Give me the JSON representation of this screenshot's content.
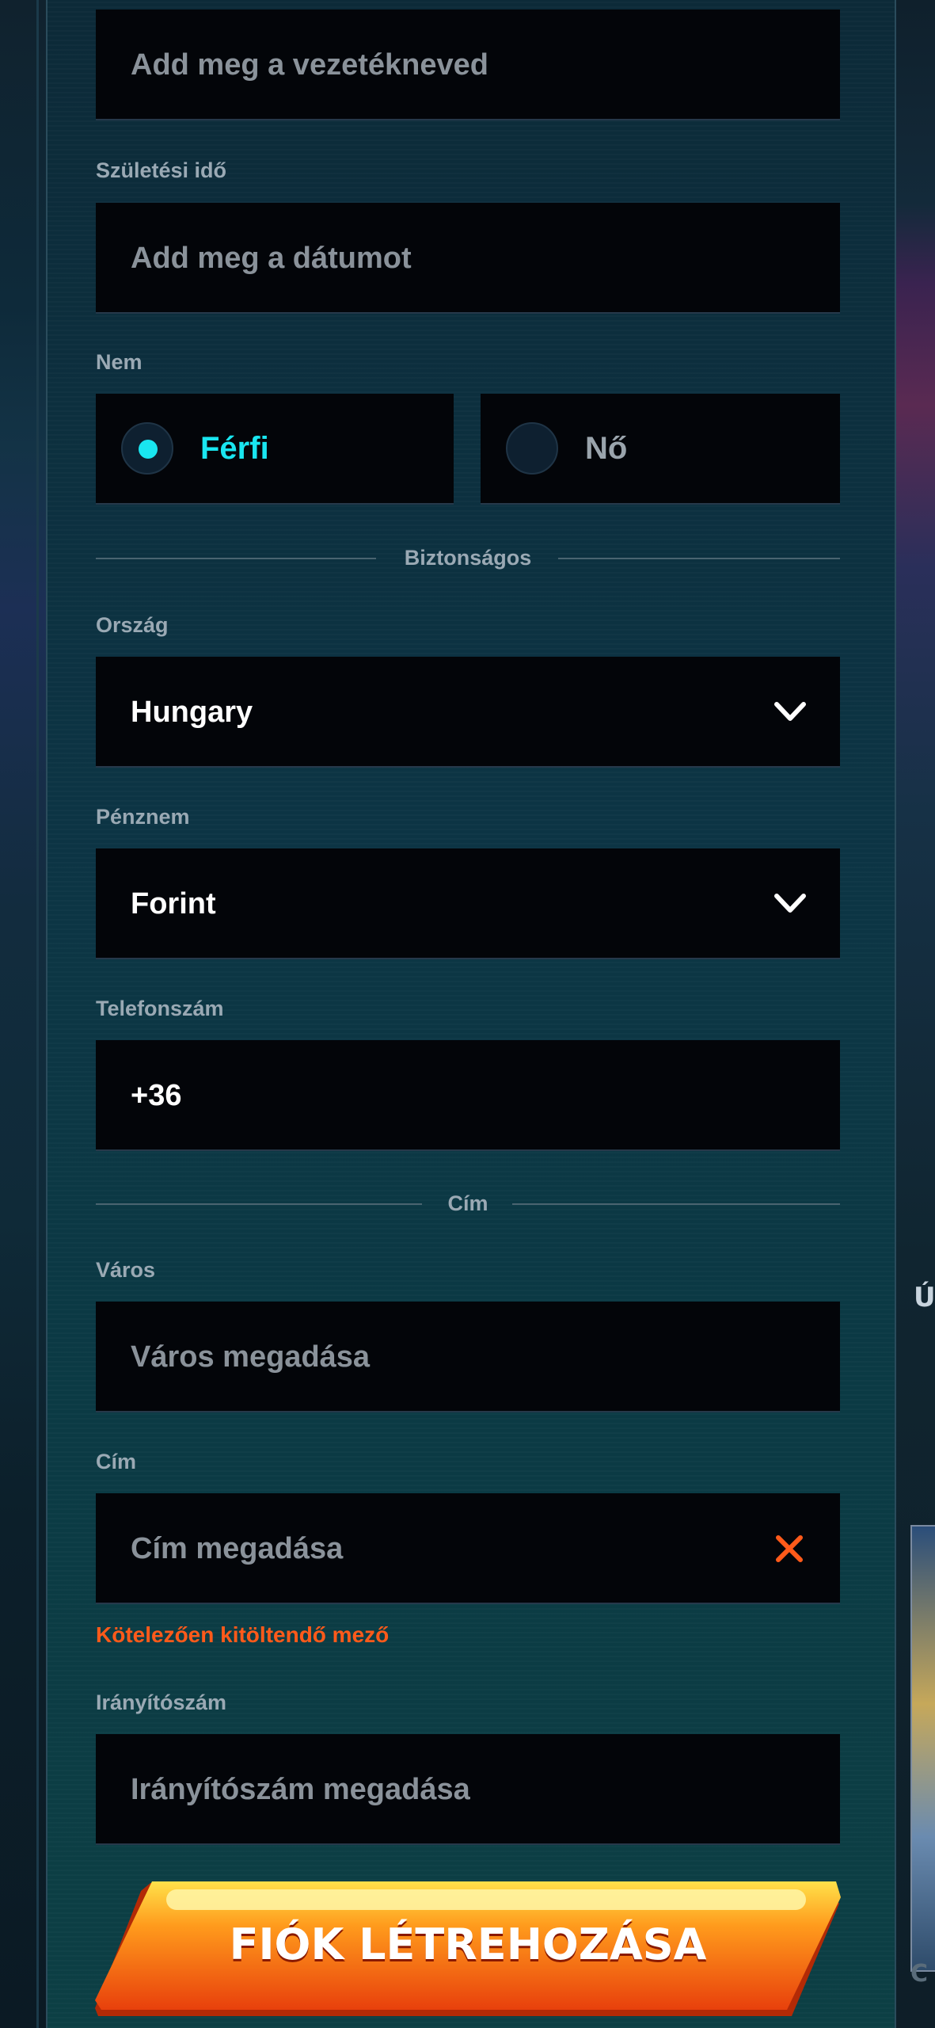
{
  "form": {
    "last_name": {
      "placeholder": "Add meg a vezetékneved"
    },
    "birthdate": {
      "label": "Születési idő",
      "placeholder": "Add meg a dátumot"
    },
    "gender": {
      "label": "Nem",
      "options": [
        "Férfi",
        "Nő"
      ],
      "selected": "Férfi"
    },
    "section_secure": "Biztonságos",
    "country": {
      "label": "Ország",
      "value": "Hungary"
    },
    "currency": {
      "label": "Pénznem",
      "value": "Forint"
    },
    "phone": {
      "label": "Telefonszám",
      "value": "+36"
    },
    "section_address": "Cím",
    "city": {
      "label": "Város",
      "placeholder": "Város megadása"
    },
    "address": {
      "label": "Cím",
      "placeholder": "Cím megadása",
      "error": "Kötelezően kitöltendő mező"
    },
    "zip": {
      "label": "Irányítószám",
      "placeholder": "Irányítószám megadása"
    },
    "submit_label": "FIÓK LÉTREHOZÁSA"
  },
  "background": {
    "right_text_top": "Ú",
    "right_text_bottom": "C"
  },
  "colors": {
    "accent_cyan": "#19e6f0",
    "error_orange": "#ff5a1a",
    "cta_top": "#ffe14a",
    "cta_bottom": "#e8400c"
  },
  "icons": [
    "chevron-down-icon",
    "close-icon"
  ]
}
